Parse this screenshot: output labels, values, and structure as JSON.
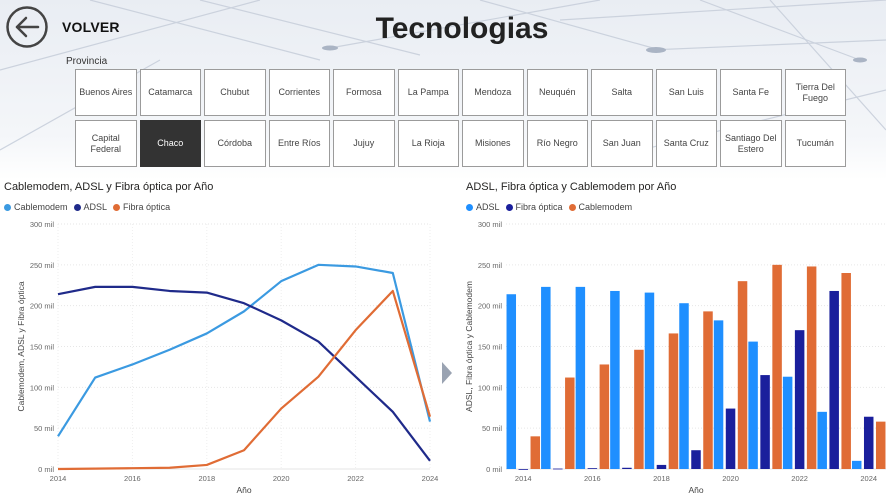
{
  "header": {
    "back_label": "VOLVER",
    "title": "Tecnologias"
  },
  "slicer": {
    "label": "Provincia",
    "row1": [
      "Buenos Aires",
      "Catamarca",
      "Chubut",
      "Corrientes",
      "Formosa",
      "La Pampa",
      "Mendoza",
      "Neuquén",
      "Salta",
      "San Luis",
      "Santa Fe",
      "Tierra Del Fuego"
    ],
    "row2": [
      "Capital Federal",
      "Chaco",
      "Córdoba",
      "Entre Ríos",
      "Jujuy",
      "La Rioja",
      "Misiones",
      "Río Negro",
      "San Juan",
      "Santa Cruz",
      "Santiago Del Estero",
      "Tucumán"
    ],
    "selected": "Chaco"
  },
  "colors": {
    "cablemodem_line": "#3b9ae1",
    "adsl_line": "#1f2a8a",
    "fibra": "#e06c35",
    "adsl_bar": "#1f8fff",
    "fibra_bar_dark": "#1a1f9c"
  },
  "chart_data": [
    {
      "type": "line",
      "title": "Cablemodem, ADSL y Fibra óptica por Año",
      "xlabel": "Año",
      "ylabel": "Cablemodem, ADSL y Fibra óptica",
      "x": [
        2014,
        2015,
        2016,
        2017,
        2018,
        2019,
        2020,
        2021,
        2022,
        2023,
        2024
      ],
      "x_ticks": [
        "2014",
        "2016",
        "2018",
        "2020",
        "2022",
        "2024"
      ],
      "y_ticks": [
        "0 mil",
        "50 mil",
        "100 mil",
        "150 mil",
        "200 mil",
        "250 mil",
        "300 mil"
      ],
      "ylim": [
        0,
        300000
      ],
      "legend_position": "top-left",
      "grid": true,
      "series": [
        {
          "name": "Cablemodem",
          "color": "#3b9ae1",
          "values": [
            40000,
            112000,
            128000,
            146000,
            166000,
            193000,
            230000,
            250000,
            248000,
            240000,
            58000
          ]
        },
        {
          "name": "ADSL",
          "color": "#1f2a8a",
          "values": [
            214000,
            223000,
            223000,
            218000,
            216000,
            203000,
            182000,
            156000,
            113000,
            70000,
            10000
          ]
        },
        {
          "name": "Fibra óptica",
          "color": "#e06c35",
          "values": [
            0,
            500,
            1000,
            1500,
            5000,
            23000,
            74000,
            113000,
            170000,
            218000,
            64000
          ]
        }
      ]
    },
    {
      "type": "bar",
      "title": "ADSL, Fibra óptica y Cablemodem por Año",
      "xlabel": "Año",
      "ylabel": "ADSL, Fibra óptica y Cablemodem",
      "categories": [
        2014,
        2015,
        2016,
        2017,
        2018,
        2019,
        2020,
        2021,
        2022,
        2023,
        2024
      ],
      "x_ticks": [
        "2014",
        "2016",
        "2018",
        "2020",
        "2022",
        "2024"
      ],
      "y_ticks": [
        "0 mil",
        "50 mil",
        "100 mil",
        "150 mil",
        "200 mil",
        "250 mil",
        "300 mil"
      ],
      "ylim": [
        0,
        300000
      ],
      "legend_position": "top-left",
      "grid": true,
      "series": [
        {
          "name": "ADSL",
          "color": "#1f8fff",
          "values": [
            214000,
            223000,
            223000,
            218000,
            216000,
            203000,
            182000,
            156000,
            113000,
            70000,
            10000
          ]
        },
        {
          "name": "Fibra óptica",
          "color": "#1a1f9c",
          "values": [
            0,
            500,
            1000,
            1500,
            5000,
            23000,
            74000,
            115000,
            170000,
            218000,
            64000
          ]
        },
        {
          "name": "Cablemodem",
          "color": "#e06c35",
          "values": [
            40000,
            112000,
            128000,
            146000,
            166000,
            193000,
            230000,
            250000,
            248000,
            240000,
            58000
          ]
        }
      ]
    }
  ]
}
